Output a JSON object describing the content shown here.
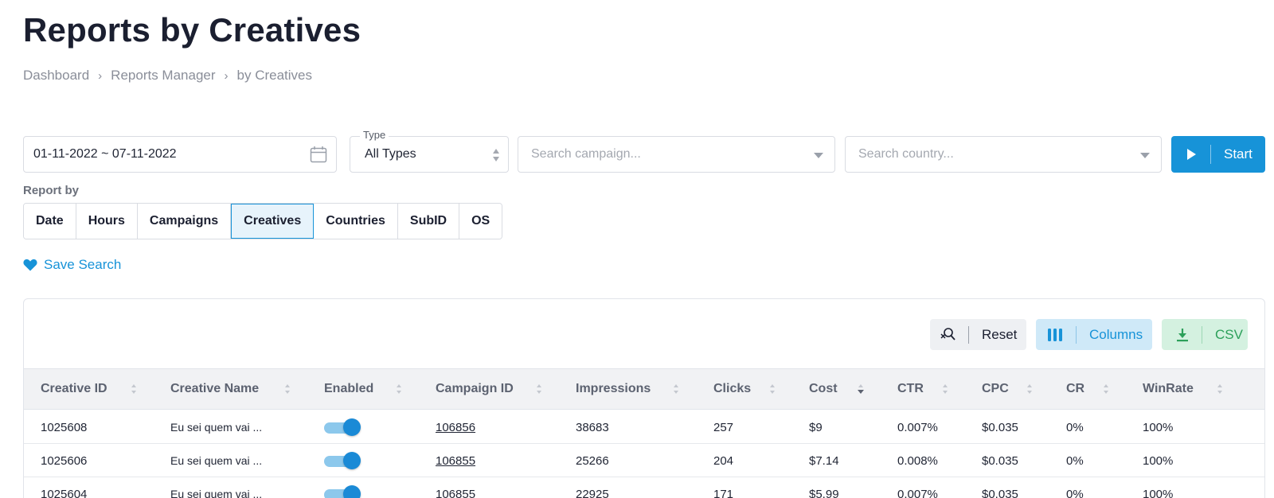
{
  "page": {
    "title": "Reports by Creatives",
    "breadcrumb": [
      "Dashboard",
      "Reports Manager",
      "by Creatives"
    ]
  },
  "filters": {
    "date_range": "01-11-2022 ~ 07-11-2022",
    "type_label": "Type",
    "type_value": "All Types",
    "campaign_placeholder": "Search campaign...",
    "country_placeholder": "Search country...",
    "start_label": "Start"
  },
  "report_by": {
    "label": "Report by",
    "options": [
      "Date",
      "Hours",
      "Campaigns",
      "Creatives",
      "Countries",
      "SubID",
      "OS"
    ],
    "active": "Creatives"
  },
  "save_search_label": "Save Search",
  "toolbar": {
    "reset_label": "Reset",
    "columns_label": "Columns",
    "csv_label": "CSV"
  },
  "table": {
    "columns": [
      "Creative ID",
      "Creative Name",
      "Enabled",
      "Campaign ID",
      "Impressions",
      "Clicks",
      "Cost",
      "CTR",
      "CPC",
      "CR",
      "WinRate"
    ],
    "sorted_column": "Cost",
    "rows": [
      {
        "creative_id": "1025608",
        "creative_name": "Eu sei quem vai ...",
        "enabled": true,
        "campaign_id": "106856",
        "impressions": "38683",
        "clicks": "257",
        "cost": "$9",
        "ctr": "0.007%",
        "cpc": "$0.035",
        "cr": "0%",
        "winrate": "100%"
      },
      {
        "creative_id": "1025606",
        "creative_name": "Eu sei quem vai ...",
        "enabled": true,
        "campaign_id": "106855",
        "impressions": "25266",
        "clicks": "204",
        "cost": "$7.14",
        "ctr": "0.008%",
        "cpc": "$0.035",
        "cr": "0%",
        "winrate": "100%"
      },
      {
        "creative_id": "1025604",
        "creative_name": "Eu sei quem vai ...",
        "enabled": true,
        "campaign_id": "106855",
        "impressions": "22925",
        "clicks": "171",
        "cost": "$5.99",
        "ctr": "0.007%",
        "cpc": "$0.035",
        "cr": "0%",
        "winrate": "100%"
      }
    ]
  },
  "colors": {
    "accent": "#1793d8",
    "csv_green": "#2ca05a",
    "text_dark": "#1b1f30"
  }
}
